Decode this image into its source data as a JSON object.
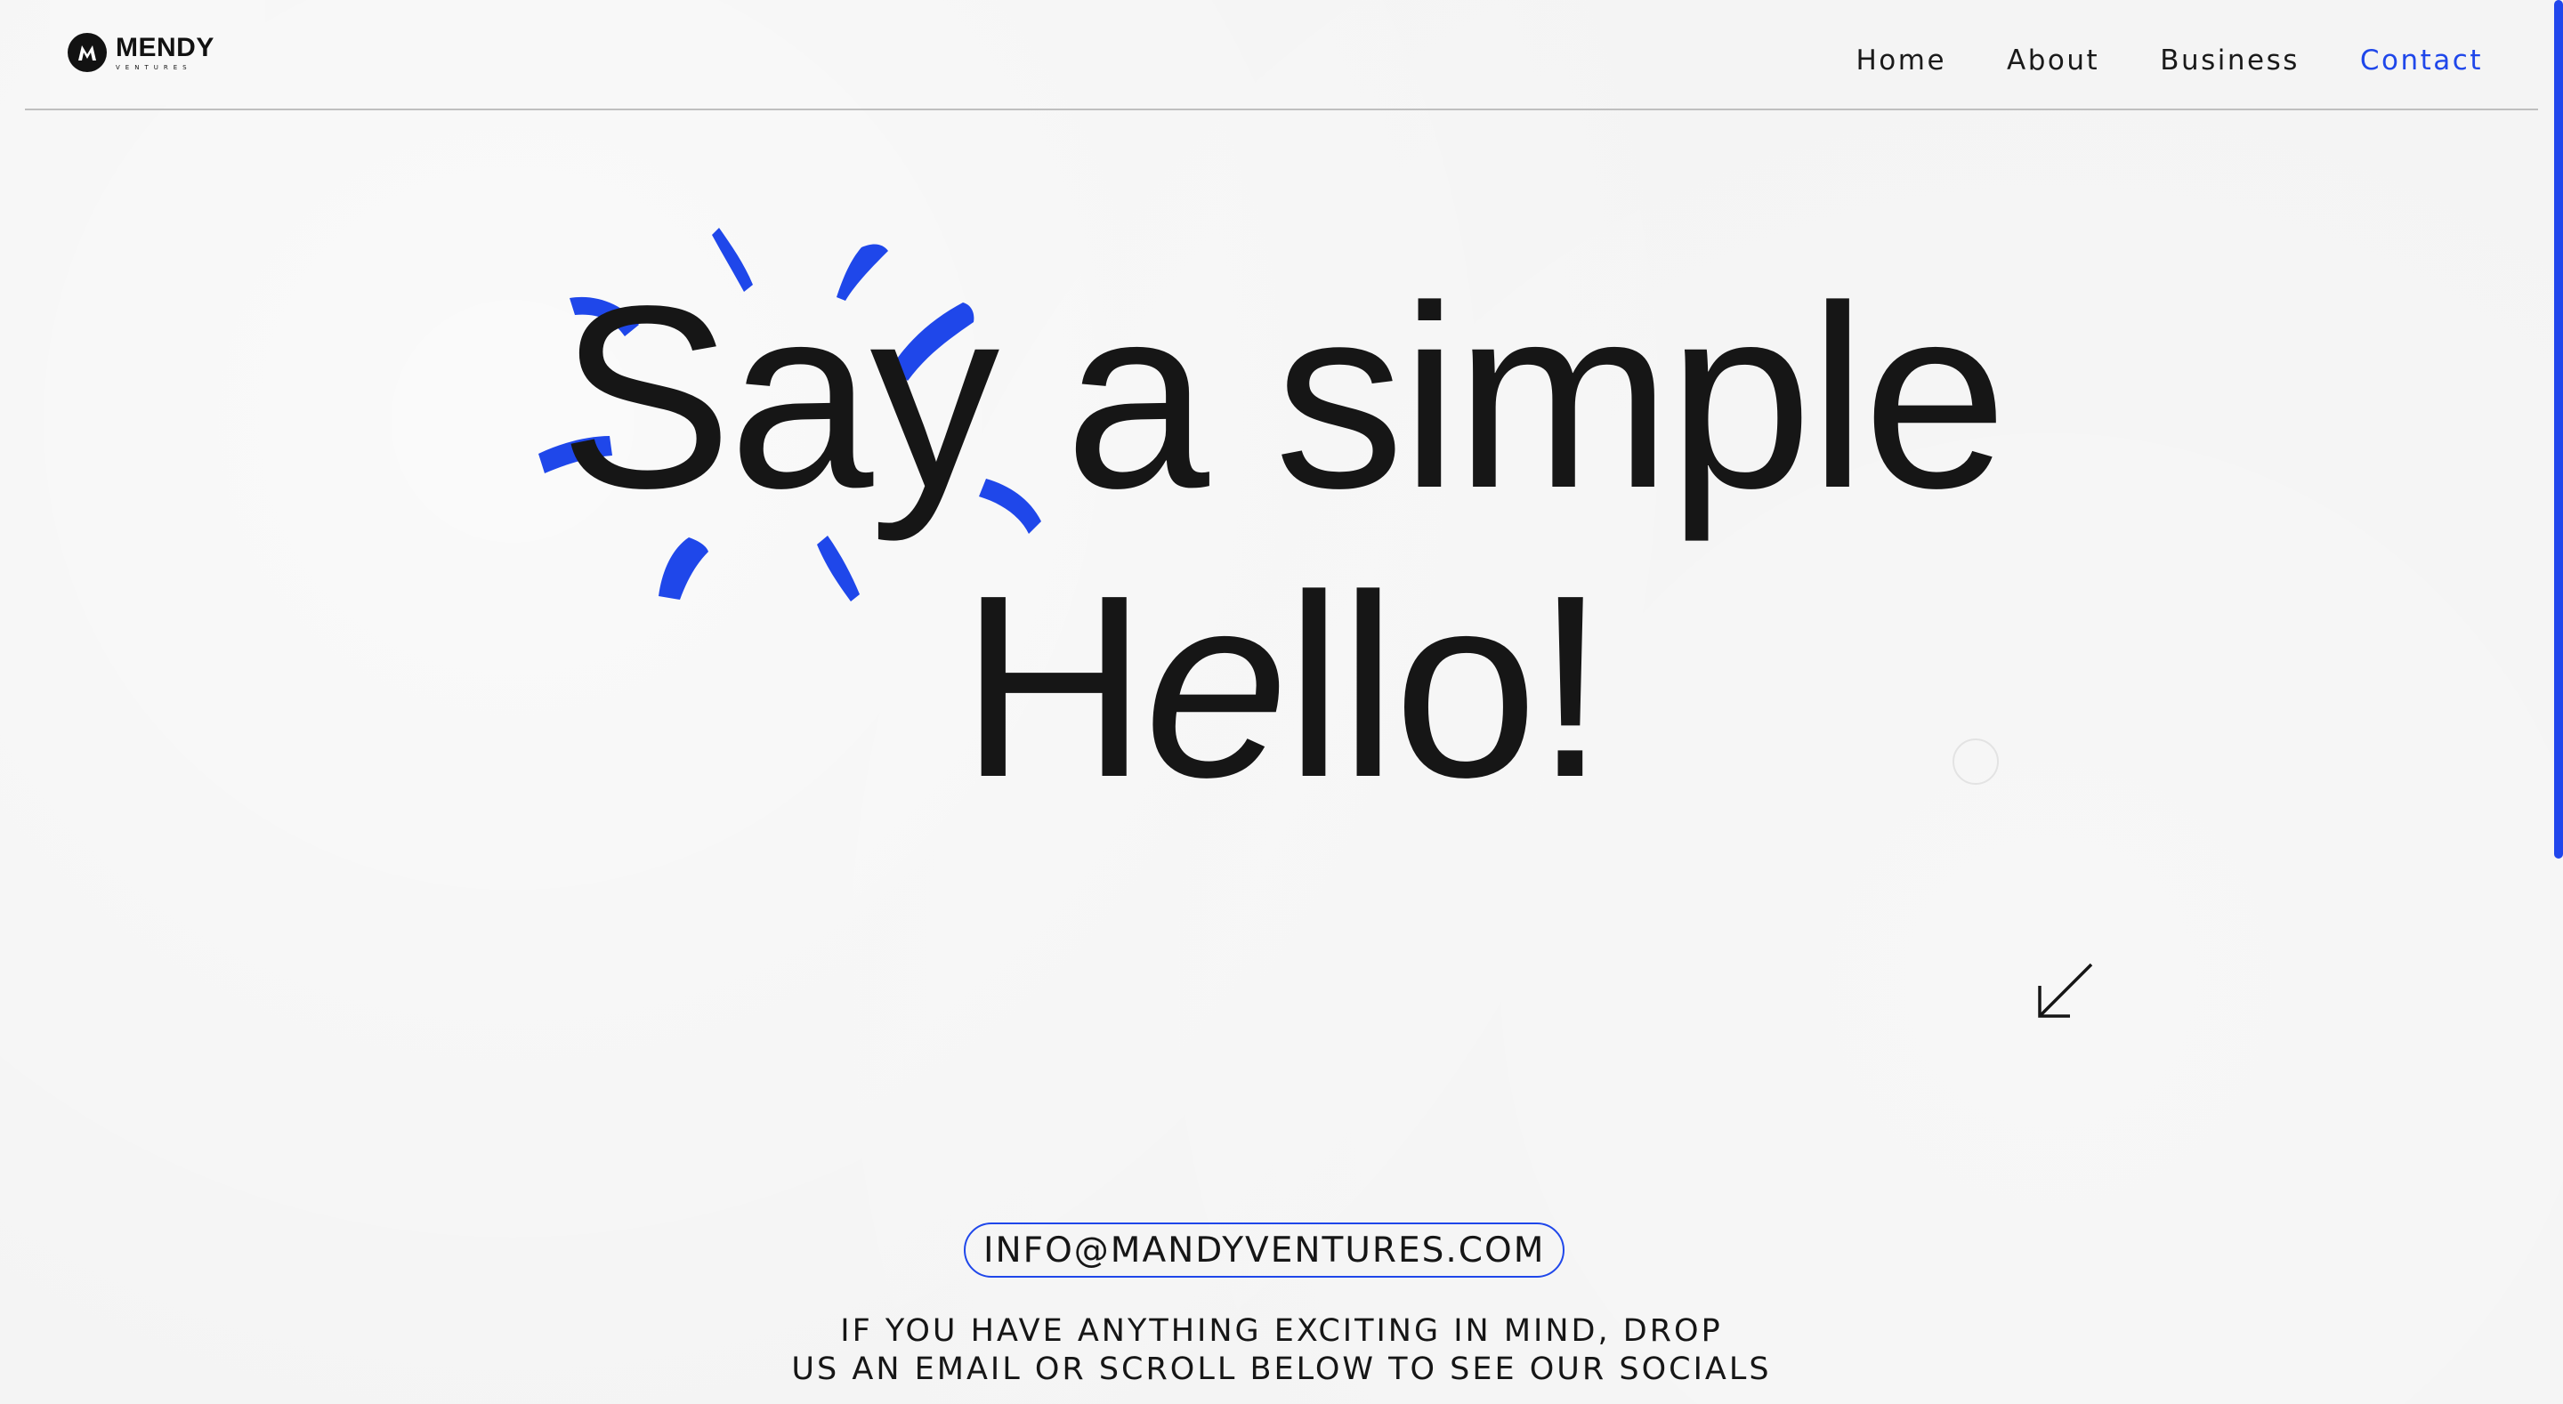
{
  "brand": {
    "name": "MENDY",
    "sub": "VENTURES",
    "mark_letter": "M"
  },
  "nav": {
    "items": [
      {
        "label": "Home",
        "active": false
      },
      {
        "label": "About",
        "active": false
      },
      {
        "label": "Business",
        "active": false
      },
      {
        "label": "Contact",
        "active": true
      }
    ]
  },
  "hero": {
    "line1": "Say a simple",
    "line2_before": "H",
    "line2_italic": "e",
    "line2_after": "llo!"
  },
  "contact": {
    "email": "INFO@MANDYVENTURES.COM",
    "tagline_line1": "IF YOU HAVE ANYTHING EXCITING IN MIND, DROP",
    "tagline_line2": "US AN EMAIL OR SCROLL BELOW TO SEE OUR SOCIALS"
  },
  "colors": {
    "accent": "#1f47ea",
    "text": "#161616",
    "background": "#f3f3f3"
  },
  "icons": {
    "arrow": "arrow-down-left-icon",
    "burst": "sparkle-burst-icon"
  }
}
